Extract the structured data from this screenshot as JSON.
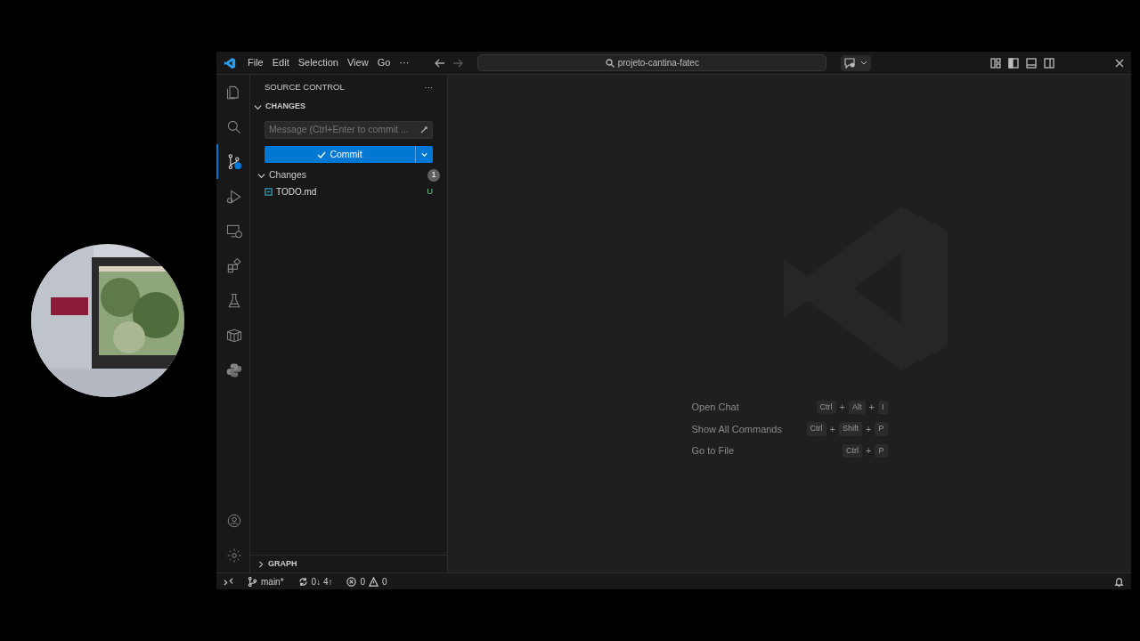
{
  "title_bar": {
    "menu": [
      "File",
      "Edit",
      "Selection",
      "View",
      "Go",
      "···"
    ],
    "search": "projeto-cantina-fatec"
  },
  "activity_bar": [
    {
      "kind": "files",
      "selected": false
    },
    {
      "kind": "search",
      "selected": false
    },
    {
      "kind": "scm",
      "selected": true
    },
    {
      "kind": "run",
      "selected": false
    },
    {
      "kind": "remote",
      "selected": false
    },
    {
      "kind": "extensions",
      "selected": false
    },
    {
      "kind": "testing",
      "selected": false
    },
    {
      "kind": "containers",
      "selected": false
    },
    {
      "kind": "python",
      "selected": false
    }
  ],
  "sidebar": {
    "title": "SOURCE CONTROL",
    "more": "···",
    "section": "CHANGES",
    "message": {
      "placeholder": "Message (Ctrl+Enter to commit ..."
    },
    "commit_button": "Commit",
    "group": {
      "label": "Changes",
      "count": "1",
      "expanded": true
    },
    "files": [
      {
        "name": "TODO.md",
        "status": "U"
      }
    ],
    "graph": {
      "label": "GRAPH",
      "expanded": false
    }
  },
  "editor": {
    "shortcuts": [
      {
        "label": "Open Chat",
        "keys": [
          "Ctrl",
          "+",
          "Alt",
          "+",
          "I"
        ]
      },
      {
        "label": "Show All Commands",
        "keys": [
          "Ctrl",
          "+",
          "Shift",
          "+",
          "P"
        ]
      },
      {
        "label": "Go to File",
        "keys": [
          "Ctrl",
          "+",
          "P"
        ]
      }
    ]
  },
  "status_bar": {
    "branch": "main*",
    "sync": "0↓ 4↑",
    "errors": "0",
    "warnings": "0"
  }
}
